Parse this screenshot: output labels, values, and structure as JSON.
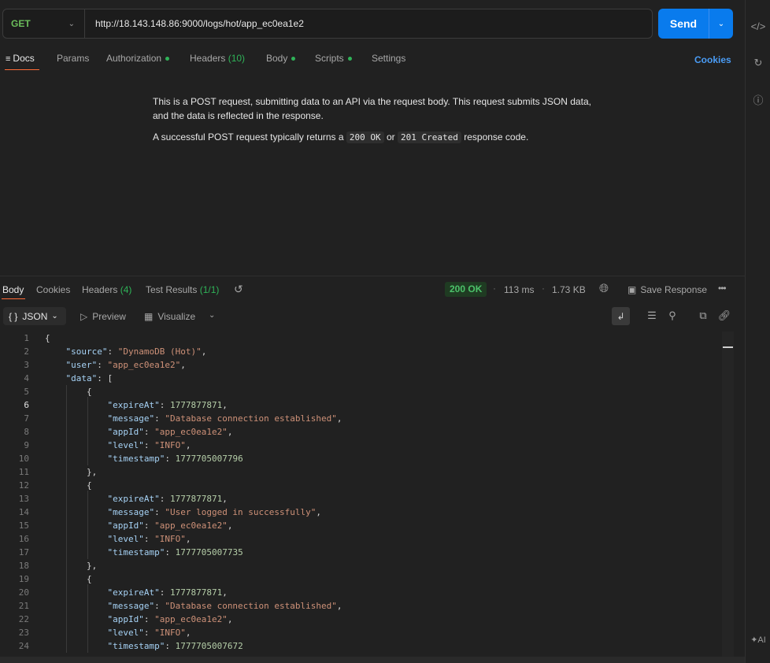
{
  "request": {
    "method": "GET",
    "url": "http://18.143.148.86:9000/logs/hot/app_ec0ea1e2",
    "send_label": "Send"
  },
  "request_tabs": {
    "docs": "Docs",
    "params": "Params",
    "authorization": "Authorization",
    "headers": "Headers",
    "headers_count": "(10)",
    "body": "Body",
    "scripts": "Scripts",
    "settings": "Settings",
    "cookies": "Cookies"
  },
  "docs": {
    "para1": "This is a POST request, submitting data to an API via the request body. This request submits JSON data, and the data is reflected in the response.",
    "para2_pre": "A successful POST request typically returns a",
    "code1": "200 OK",
    "para2_mid": "or",
    "code2": "201 Created",
    "para2_post": "response code."
  },
  "response_tabs": {
    "body": "Body",
    "cookies": "Cookies",
    "headers": "Headers",
    "headers_count": "(4)",
    "test_results": "Test Results",
    "test_count": "(1/1)"
  },
  "response_meta": {
    "status": "200 OK",
    "time": "113 ms",
    "size": "1.73 KB",
    "save": "Save Response"
  },
  "format_bar": {
    "format": "JSON",
    "preview": "Preview",
    "visualize": "Visualize"
  },
  "icons": {
    "code": "code-icon",
    "history": "history-icon",
    "info": "info-icon",
    "globe": "globe-icon",
    "more": "more-icon",
    "wrap": "wrap-icon",
    "filter": "filter-icon",
    "search": "search-icon",
    "copy": "copy-icon",
    "link": "link-icon",
    "ai": "ai-icon"
  },
  "body_lines": [
    {
      "n": "1",
      "html": "{"
    },
    {
      "n": "2",
      "html": "    <span class='k'>\"source\"</span>: <span class='s'>\"DynamoDB (Hot)\"</span>,"
    },
    {
      "n": "3",
      "html": "    <span class='k'>\"user\"</span>: <span class='s'>\"app_ec0ea1e2\"</span>,"
    },
    {
      "n": "4",
      "html": "    <span class='k'>\"data\"</span>: ["
    },
    {
      "n": "5",
      "html": "        {"
    },
    {
      "n": "6",
      "html": "            <span class='k'>\"expireAt\"</span>: <span class='n'>1777877871</span>,"
    },
    {
      "n": "7",
      "html": "            <span class='k'>\"message\"</span>: <span class='s'>\"Database connection established\"</span>,"
    },
    {
      "n": "8",
      "html": "            <span class='k'>\"appId\"</span>: <span class='s'>\"app_ec0ea1e2\"</span>,"
    },
    {
      "n": "9",
      "html": "            <span class='k'>\"level\"</span>: <span class='s'>\"INFO\"</span>,"
    },
    {
      "n": "10",
      "html": "            <span class='k'>\"timestamp\"</span>: <span class='n'>1777705007796</span>"
    },
    {
      "n": "11",
      "html": "        },"
    },
    {
      "n": "12",
      "html": "        {"
    },
    {
      "n": "13",
      "html": "            <span class='k'>\"expireAt\"</span>: <span class='n'>1777877871</span>,"
    },
    {
      "n": "14",
      "html": "            <span class='k'>\"message\"</span>: <span class='s'>\"User logged in successfully\"</span>,"
    },
    {
      "n": "15",
      "html": "            <span class='k'>\"appId\"</span>: <span class='s'>\"app_ec0ea1e2\"</span>,"
    },
    {
      "n": "16",
      "html": "            <span class='k'>\"level\"</span>: <span class='s'>\"INFO\"</span>,"
    },
    {
      "n": "17",
      "html": "            <span class='k'>\"timestamp\"</span>: <span class='n'>1777705007735</span>"
    },
    {
      "n": "18",
      "html": "        },"
    },
    {
      "n": "19",
      "html": "        {"
    },
    {
      "n": "20",
      "html": "            <span class='k'>\"expireAt\"</span>: <span class='n'>1777877871</span>,"
    },
    {
      "n": "21",
      "html": "            <span class='k'>\"message\"</span>: <span class='s'>\"Database connection established\"</span>,"
    },
    {
      "n": "22",
      "html": "            <span class='k'>\"appId\"</span>: <span class='s'>\"app_ec0ea1e2\"</span>,"
    },
    {
      "n": "23",
      "html": "            <span class='k'>\"level\"</span>: <span class='s'>\"INFO\"</span>,"
    },
    {
      "n": "24",
      "html": "            <span class='k'>\"timestamp\"</span>: <span class='n'>1777705007672</span>"
    }
  ],
  "current_line": "6"
}
